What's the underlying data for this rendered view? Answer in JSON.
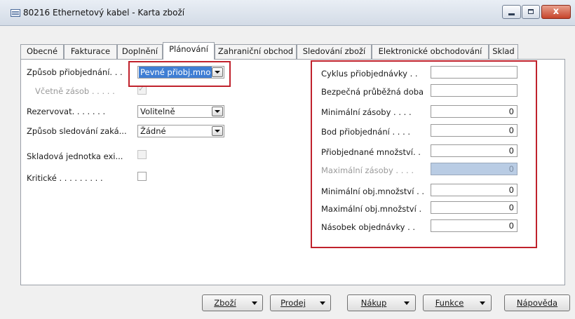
{
  "window": {
    "title": "80216 Ethernetový kabel - Karta zboží",
    "close_glyph": "x",
    "icons": [
      "card-icon",
      "minimize-icon",
      "maximize-icon",
      "close-icon"
    ]
  },
  "tabs": [
    {
      "label": "Obecné"
    },
    {
      "label": "Fakturace"
    },
    {
      "label": "Doplnění"
    },
    {
      "label": "Plánování",
      "active": true
    },
    {
      "label": "Zahraniční obchod"
    },
    {
      "label": "Sledování zboží"
    },
    {
      "label": "Elektronické obchodování"
    },
    {
      "label": "Sklad"
    }
  ],
  "left": {
    "reorder_policy": {
      "label": "Způsob přiobjednání. . .",
      "value": "Pevné přiobj.mno"
    },
    "include_inventory": {
      "label": "Včetně zásob . . . . .",
      "checked": true
    },
    "reserve": {
      "label": "Rezervovat. . . . . . .",
      "value": "Volitelně"
    },
    "order_tracking": {
      "label": "Způsob sledování zaká...",
      "value": "Žádné"
    },
    "sku_exists": {
      "label": "Skladová jednotka exi...",
      "checked": false
    },
    "critical": {
      "label": "Kritické . . . . . . . . .",
      "checked": false
    }
  },
  "right": {
    "reorder_cycle": {
      "label": "Cyklus přiobjednávky . .",
      "value": ""
    },
    "safety_lead_time": {
      "label": "Bezpečná průběžná doba",
      "value": ""
    },
    "safety_stock": {
      "label": "Minimální zásoby . . . .",
      "value": "0"
    },
    "reorder_point": {
      "label": "Bod přiobjednání . . . .",
      "value": "0"
    },
    "reorder_quantity": {
      "label": "Přiobjednané množství. .",
      "value": "0"
    },
    "maximum_inventory": {
      "label": "Maximální zásoby . . . .",
      "value": "0"
    },
    "min_order_qty": {
      "label": "Minimální obj.množství . .",
      "value": "0"
    },
    "max_order_qty": {
      "label": "Maximální obj.množství .",
      "value": "0"
    },
    "order_multiple": {
      "label": "Násobek objednávky . .",
      "value": "0"
    }
  },
  "buttons": {
    "item": "Zboží",
    "sales": "Prodej",
    "purchase": "Nákup",
    "functions": "Funkce",
    "help": "Nápověda"
  },
  "colors": {
    "highlight_box": "#c0222c",
    "selection": "#3f7ed4",
    "disabled_field": "#b9cce4"
  }
}
